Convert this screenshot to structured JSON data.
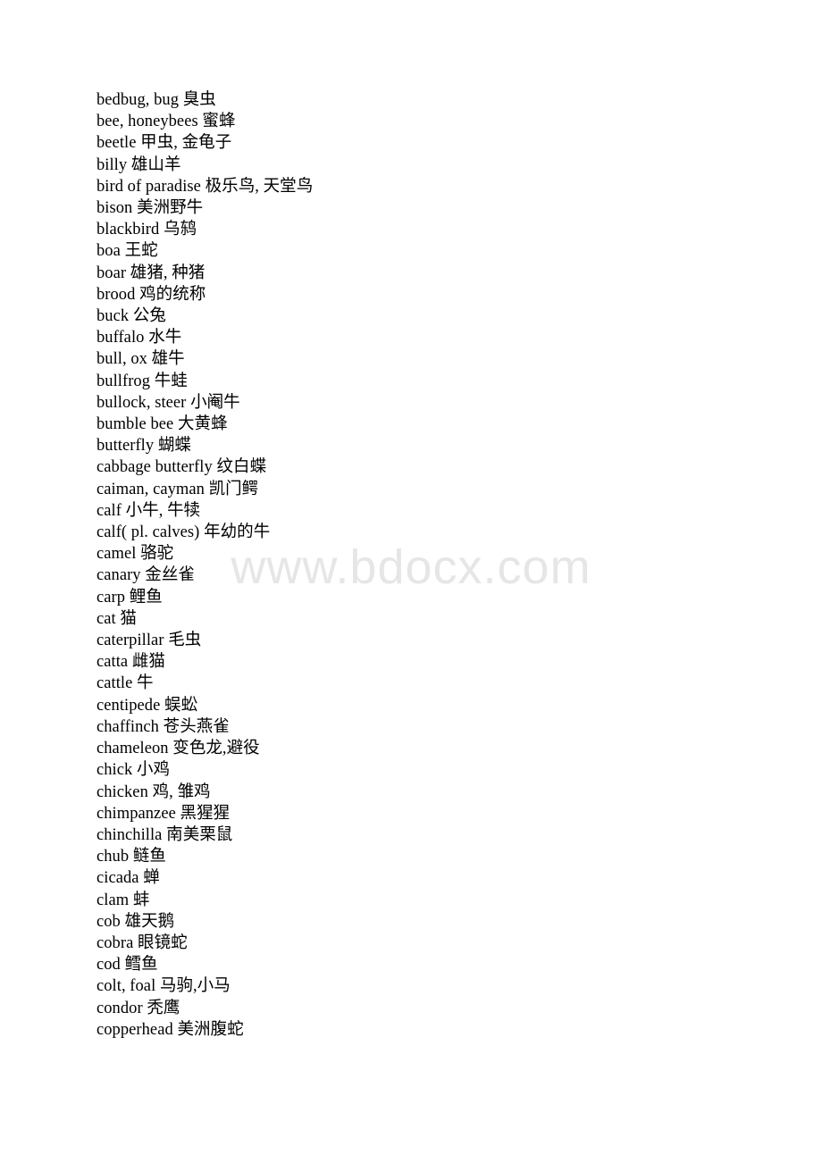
{
  "document": {
    "type": "glossary",
    "language_pair": "English-Chinese",
    "watermark": "www.bdocx.com",
    "entries": [
      {
        "term": "bedbug, bug",
        "gloss": "臭虫"
      },
      {
        "term": "bee, honeybees",
        "gloss": "蜜蜂"
      },
      {
        "term": "beetle",
        "gloss": "甲虫, 金龟子"
      },
      {
        "term": "billy",
        "gloss": "雄山羊"
      },
      {
        "term": "bird of paradise",
        "gloss": "极乐鸟, 天堂鸟"
      },
      {
        "term": "bison",
        "gloss": "美洲野牛"
      },
      {
        "term": "blackbird",
        "gloss": "乌鸫"
      },
      {
        "term": "boa",
        "gloss": "王蛇"
      },
      {
        "term": "boar",
        "gloss": "雄猪, 种猪"
      },
      {
        "term": "brood",
        "gloss": "鸡的统称"
      },
      {
        "term": "buck",
        "gloss": "公兔"
      },
      {
        "term": "buffalo",
        "gloss": "水牛"
      },
      {
        "term": "bull, ox",
        "gloss": "雄牛"
      },
      {
        "term": "bullfrog",
        "gloss": "牛蛙"
      },
      {
        "term": "bullock, steer",
        "gloss": "小阉牛"
      },
      {
        "term": "bumble bee",
        "gloss": "大黄蜂"
      },
      {
        "term": "butterfly",
        "gloss": "蝴蝶"
      },
      {
        "term": "cabbage butterfly",
        "gloss": "纹白蝶"
      },
      {
        "term": "caiman, cayman",
        "gloss": "凯门鳄"
      },
      {
        "term": "calf",
        "gloss": "小牛, 牛犊"
      },
      {
        "term": "calf( pl. calves)",
        "gloss": "年幼的牛"
      },
      {
        "term": "camel",
        "gloss": "骆驼"
      },
      {
        "term": "canary",
        "gloss": "金丝雀"
      },
      {
        "term": "carp",
        "gloss": "鲤鱼"
      },
      {
        "term": "cat",
        "gloss": "猫"
      },
      {
        "term": "caterpillar",
        "gloss": "毛虫"
      },
      {
        "term": "catta",
        "gloss": "雌猫"
      },
      {
        "term": "cattle",
        "gloss": "牛"
      },
      {
        "term": "centipede",
        "gloss": "蜈蚣"
      },
      {
        "term": "chaffinch",
        "gloss": "苍头燕雀"
      },
      {
        "term": "chameleon",
        "gloss": "变色龙,避役"
      },
      {
        "term": "chick",
        "gloss": "小鸡"
      },
      {
        "term": "chicken",
        "gloss": "鸡, 雏鸡"
      },
      {
        "term": "chimpanzee",
        "gloss": "黑猩猩"
      },
      {
        "term": "chinchilla",
        "gloss": "南美栗鼠"
      },
      {
        "term": "chub",
        "gloss": "鲢鱼"
      },
      {
        "term": "cicada",
        "gloss": "蝉"
      },
      {
        "term": "clam",
        "gloss": "蚌"
      },
      {
        "term": "cob",
        "gloss": "雄天鹅"
      },
      {
        "term": "cobra",
        "gloss": "眼镜蛇"
      },
      {
        "term": "cod",
        "gloss": "鳕鱼"
      },
      {
        "term": "colt, foal",
        "gloss": "马驹,小马"
      },
      {
        "term": "condor",
        "gloss": "秃鹰"
      },
      {
        "term": "copperhead",
        "gloss": "美洲腹蛇"
      }
    ]
  }
}
